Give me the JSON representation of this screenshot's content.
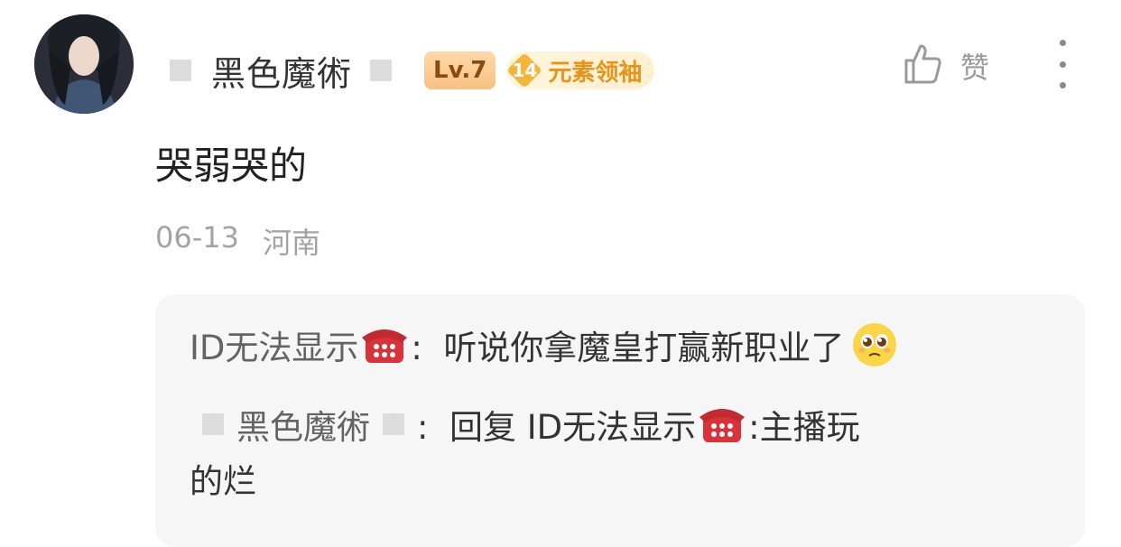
{
  "post": {
    "username": "黑色魔術",
    "level_badge": "Lv.7",
    "fan_badge": {
      "level": "14",
      "label": "元素领袖"
    },
    "like_label": "赞",
    "comment_text": "哭弱哭的",
    "date": "06-13",
    "location": "河南"
  },
  "replies": [
    {
      "author": "ID无法显示",
      "author_icon": "telephone-icon",
      "separator": ":",
      "text": "听说你拿魔皇打赢新职业了",
      "trailing_icon": "pleading-face-emoji"
    },
    {
      "author": "黑色魔術",
      "separator": ":",
      "prefix": "回复",
      "target": "ID无法显示",
      "target_icon": "telephone-icon",
      "text_line1": ":主播玩",
      "text_line2": "的烂"
    }
  ],
  "colors": {
    "username": "#333333",
    "level_badge_bg": "#f7c083",
    "fan_badge_text": "#e8941a",
    "meta_text": "#a3a3a3",
    "reply_bg": "#f6f6f7"
  }
}
